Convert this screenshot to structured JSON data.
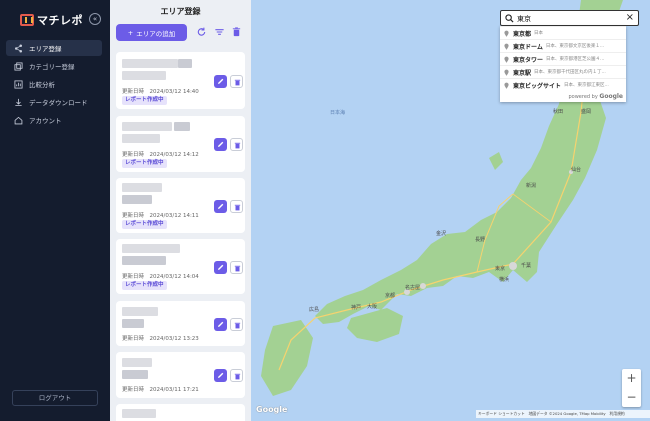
{
  "sidebar": {
    "logo_text": "マチレポ",
    "collapse_symbol": "«",
    "items": [
      {
        "label": "エリア登録",
        "icon": "share-icon",
        "active": true
      },
      {
        "label": "カテゴリー登録",
        "icon": "layers-icon",
        "active": false
      },
      {
        "label": "比較分析",
        "icon": "chart-icon",
        "active": false
      },
      {
        "label": "データダウンロード",
        "icon": "download-icon",
        "active": false
      },
      {
        "label": "アカウント",
        "icon": "home-icon",
        "active": false
      }
    ],
    "logout_label": "ログアウト"
  },
  "panel": {
    "title": "エリア登録",
    "add_button_label": "エリアの追加",
    "add_button_icon": "+",
    "cards": [
      {
        "date": "更新日時　2024/03/12 14:40",
        "badge": "レポート作成中"
      },
      {
        "date": "更新日時　2024/03/12 14:12",
        "badge": "レポート作成中"
      },
      {
        "date": "更新日時　2024/03/12 14:11",
        "badge": "レポート作成中"
      },
      {
        "date": "更新日時　2024/03/12 14:04",
        "badge": "レポート作成中"
      },
      {
        "date": "更新日時　2024/03/12 13:23",
        "badge": ""
      },
      {
        "date": "更新日時　2024/03/11 17:21",
        "badge": ""
      }
    ]
  },
  "map": {
    "search_value": "東京",
    "suggestions": [
      {
        "main": "東京都",
        "sub": "日本"
      },
      {
        "main": "東京ドーム",
        "sub": "日本、東京都文京区後楽１..."
      },
      {
        "main": "東京タワー",
        "sub": "日本、東京都港区芝公園４..."
      },
      {
        "main": "東京駅",
        "sub": "日本、東京都千代田区丸の内１丁..."
      },
      {
        "main": "東京ビッグサイト",
        "sub": "日本、東京都江東区..."
      }
    ],
    "powered_by": "powered by",
    "powered_brand": "Google",
    "labels": {
      "sea": "日本海",
      "aomori": "青森",
      "akita": "秋田",
      "morioka": "盛岡",
      "sendai": "仙台",
      "niigata": "新潟",
      "kanazawa": "金沢",
      "nagano": "長野",
      "tokyo": "東京",
      "yokohama": "横浜",
      "nagoya": "名古屋",
      "kyoto": "京都",
      "osaka": "大阪",
      "kobe": "神戸",
      "hiroshima": "広島",
      "chiba": "千葉"
    },
    "zoom_in": "+",
    "zoom_out": "−",
    "google_logo": "Google",
    "attribution": "キーボード ショートカット　地図データ ©2024 Google, TMap Mobility　利用規約",
    "colors": {
      "water": "#b3d2f3",
      "land": "#cfe3c0",
      "forest": "#9ccf8e",
      "road": "#f6d36f"
    }
  }
}
